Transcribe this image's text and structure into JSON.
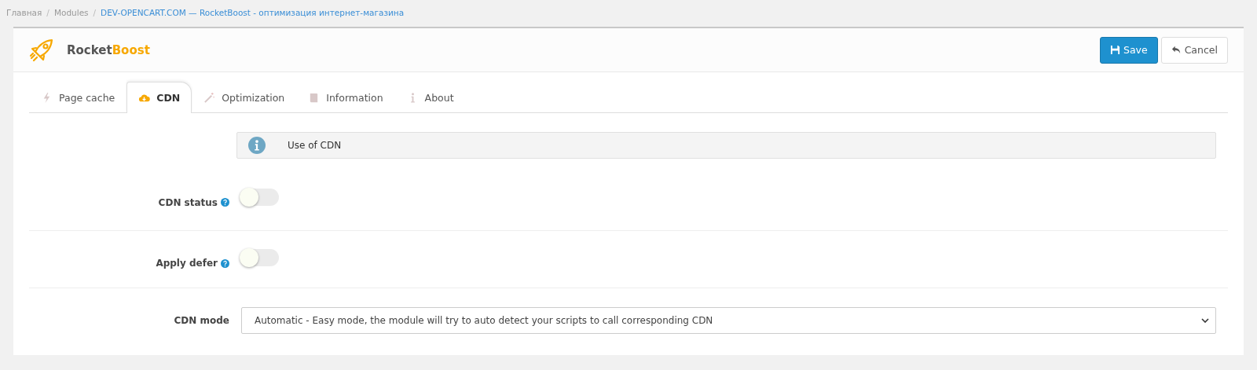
{
  "breadcrumb": [
    {
      "label": "Главная",
      "kind": "plain"
    },
    {
      "sep": "/",
      "label": "Modules",
      "kind": "plain"
    },
    {
      "sep": "/",
      "label": "DEV-OPENCART.COM — RocketBoost - оптимизация интернет-магазина",
      "kind": "link"
    }
  ],
  "header": {
    "title_main": "Rocket",
    "title_accent": "Boost",
    "buttons": [
      {
        "label": "Save",
        "kind": "primary"
      },
      {
        "label": "Cancel",
        "kind": "default"
      }
    ]
  },
  "tabs": [
    {
      "label": "Page cache",
      "selected": false
    },
    {
      "label": "CDN",
      "selected": true
    },
    {
      "label": "Optimization",
      "selected": false
    },
    {
      "label": "Information",
      "selected": false
    },
    {
      "label": "About",
      "selected": false
    }
  ],
  "info": {
    "text": "Use of CDN"
  },
  "fields": [
    {
      "label": "CDN status",
      "kind": "toggle",
      "on": false,
      "help": true
    },
    {
      "label": "Apply defer",
      "kind": "toggle",
      "on": false,
      "help": true
    },
    {
      "label": "CDN mode",
      "kind": "select",
      "value": "Automatic - Easy mode, the module will try to auto detect your scripts to call corresponding CDN"
    }
  ]
}
